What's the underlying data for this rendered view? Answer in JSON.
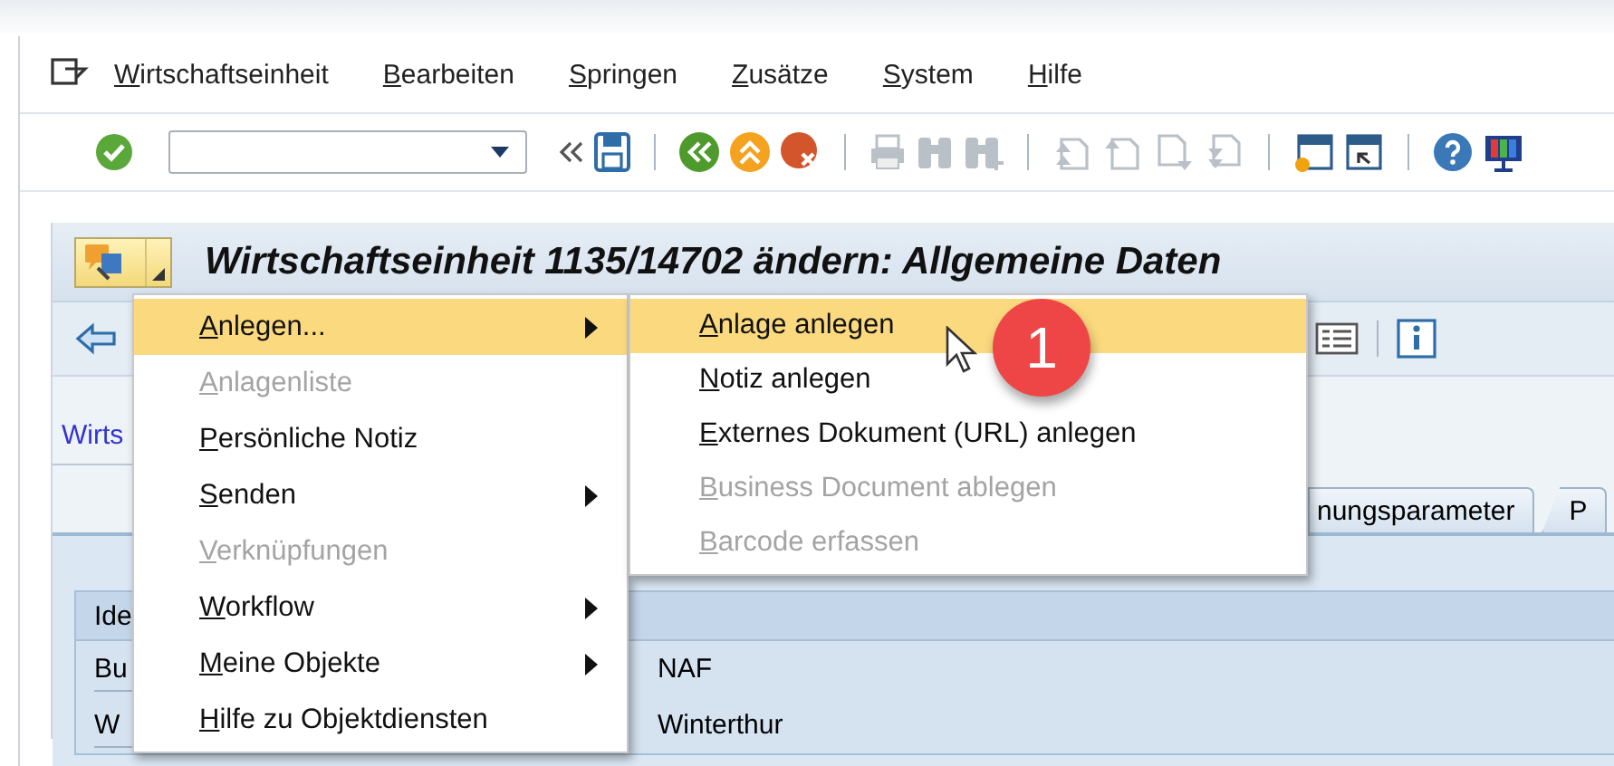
{
  "menubar": {
    "items": [
      "Wirtschaftseinheit",
      "Bearbeiten",
      "Springen",
      "Zusätze",
      "System",
      "Hilfe"
    ]
  },
  "toolbar": {
    "items": [
      {
        "kind": "enter",
        "disabled": false
      },
      {
        "kind": "command_field",
        "disabled": false
      },
      {
        "kind": "collapse",
        "disabled": false
      },
      {
        "kind": "save",
        "disabled": false
      },
      {
        "kind": "separator",
        "disabled": false
      },
      {
        "kind": "back",
        "disabled": false
      },
      {
        "kind": "exit",
        "disabled": false
      },
      {
        "kind": "cancel",
        "disabled": false
      },
      {
        "kind": "separator",
        "disabled": false
      },
      {
        "kind": "print",
        "disabled": true
      },
      {
        "kind": "find",
        "disabled": true
      },
      {
        "kind": "find_next",
        "disabled": true
      },
      {
        "kind": "separator",
        "disabled": false
      },
      {
        "kind": "first_page",
        "disabled": true
      },
      {
        "kind": "previous_page",
        "disabled": true
      },
      {
        "kind": "next_page",
        "disabled": true
      },
      {
        "kind": "last_page",
        "disabled": true
      },
      {
        "kind": "separator",
        "disabled": false
      },
      {
        "kind": "new_session",
        "disabled": false
      },
      {
        "kind": "shortcut",
        "disabled": false
      },
      {
        "kind": "separator",
        "disabled": false
      },
      {
        "kind": "help",
        "disabled": false
      },
      {
        "kind": "customize",
        "disabled": false
      }
    ]
  },
  "title": "Wirtschaftseinheit 1135/14702 ändern: Allgemeine Daten",
  "app_toolbar": {
    "items": [
      {
        "kind": "back"
      },
      {
        "kind": "list"
      },
      {
        "kind": "separator"
      },
      {
        "kind": "info"
      }
    ]
  },
  "link": "Wirts",
  "tabs": [
    {
      "label": "nungsparameter",
      "selected": false
    },
    {
      "label": "P",
      "selected": false
    }
  ],
  "group": {
    "title": "Ide",
    "rows": [
      {
        "label": "Bu",
        "value": "NAF"
      },
      {
        "label": "W",
        "value": "Winterthur"
      }
    ]
  },
  "context_menu": {
    "items": [
      {
        "label": "Anlegen...",
        "disabled": false,
        "submenu": true,
        "selected": true
      },
      {
        "label": "Anlagenliste",
        "disabled": true,
        "submenu": false,
        "selected": false
      },
      {
        "label": "Persönliche Notiz",
        "disabled": false,
        "submenu": false,
        "selected": false
      },
      {
        "label": "Senden",
        "disabled": false,
        "submenu": true,
        "selected": false
      },
      {
        "label": "Verknüpfungen",
        "disabled": true,
        "submenu": false,
        "selected": false
      },
      {
        "label": "Workflow",
        "disabled": false,
        "submenu": true,
        "selected": false
      },
      {
        "label": "Meine Objekte",
        "disabled": false,
        "submenu": true,
        "selected": false
      },
      {
        "label": "Hilfe zu Objektdiensten",
        "disabled": false,
        "submenu": false,
        "selected": false
      }
    ]
  },
  "submenu": {
    "items": [
      {
        "label": "Anlage anlegen",
        "disabled": false,
        "submenu": false,
        "selected": true
      },
      {
        "label": "Notiz anlegen",
        "disabled": false,
        "submenu": false,
        "selected": false
      },
      {
        "label": "Externes Dokument (URL) anlegen",
        "disabled": false,
        "submenu": false,
        "selected": false
      },
      {
        "label": "Business Document ablegen",
        "disabled": true,
        "submenu": false,
        "selected": false
      },
      {
        "label": "Barcode erfassen",
        "disabled": true,
        "submenu": false,
        "selected": false
      }
    ]
  },
  "step_badge": "1"
}
